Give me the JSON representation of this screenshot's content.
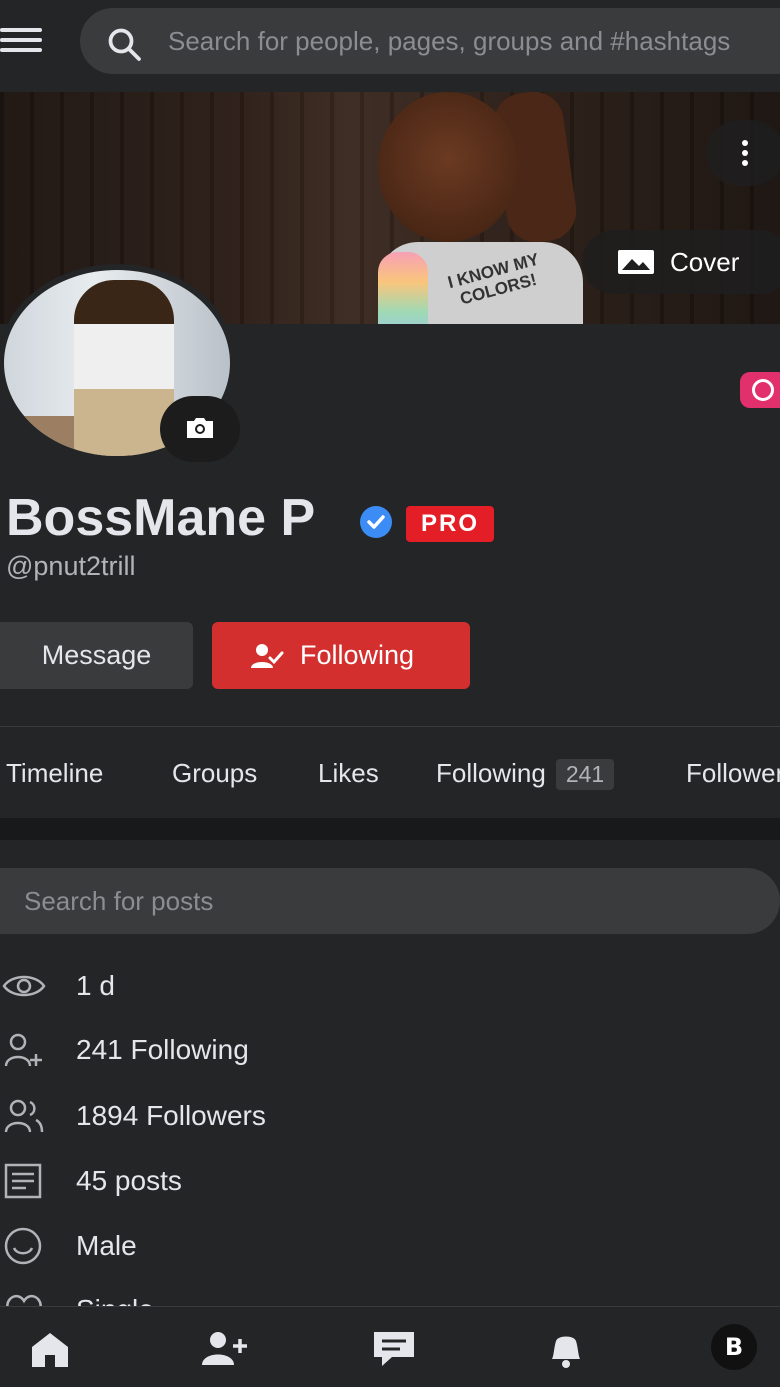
{
  "search": {
    "placeholder": "Search for people, pages, groups and #hashtags"
  },
  "cover": {
    "shirt_text": "I KNOW MY COLORS!",
    "cover_button_label": "Cover"
  },
  "profile": {
    "name": "BossMane P",
    "badge": "PRO",
    "handle": "@pnut2trill"
  },
  "actions": {
    "message_label": "Message",
    "following_label": "Following"
  },
  "tabs": [
    {
      "label": "Timeline"
    },
    {
      "label": "Groups"
    },
    {
      "label": "Likes"
    },
    {
      "label": "Following",
      "count": "241"
    },
    {
      "label": "Followers"
    }
  ],
  "post_search": {
    "placeholder": "Search for posts"
  },
  "info": [
    {
      "icon": "eye-icon",
      "text": "1 d"
    },
    {
      "icon": "user-plus-icon",
      "text": "241 Following"
    },
    {
      "icon": "users-icon",
      "text": "1894 Followers"
    },
    {
      "icon": "document-icon",
      "text": "45 posts"
    },
    {
      "icon": "smile-icon",
      "text": "Male"
    },
    {
      "icon": "heart-icon",
      "text": "Single"
    }
  ],
  "colors": {
    "accent": "#d32f2f",
    "pro_badge": "#e41e26",
    "verified": "#3b8cf5",
    "background": "#242526",
    "instagram": "#e1306c"
  },
  "bottom_nav": [
    {
      "icon": "home-icon"
    },
    {
      "icon": "add-friend-icon"
    },
    {
      "icon": "chat-icon"
    },
    {
      "icon": "bell-icon"
    },
    {
      "icon": "app-logo-avatar"
    }
  ]
}
